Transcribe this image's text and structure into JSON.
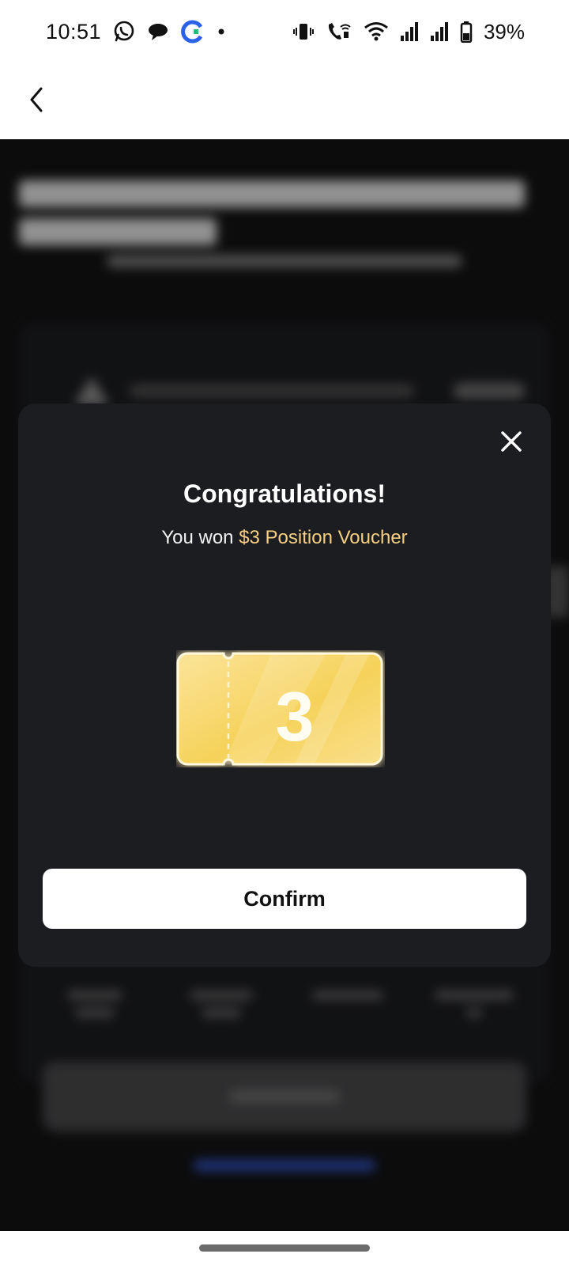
{
  "status_bar": {
    "time": "10:51",
    "battery_percent": "39%",
    "left_icons": [
      "whatsapp-icon",
      "chat-bubble-icon",
      "g-app-icon",
      "notification-dot-icon"
    ],
    "right_icons": [
      "vibrate-icon",
      "wifi-calling-icon",
      "wifi-icon",
      "signal-icon",
      "signal-icon-2",
      "battery-icon"
    ]
  },
  "header": {
    "back_icon": "chevron-left-icon"
  },
  "modal": {
    "title": "Congratulations!",
    "subtitle_prefix": "You won ",
    "subtitle_highlight": "$3 Position Voucher",
    "voucher_value": "3",
    "confirm_label": "Confirm",
    "close_icon": "close-icon",
    "highlight_color": "#f6cf82"
  }
}
